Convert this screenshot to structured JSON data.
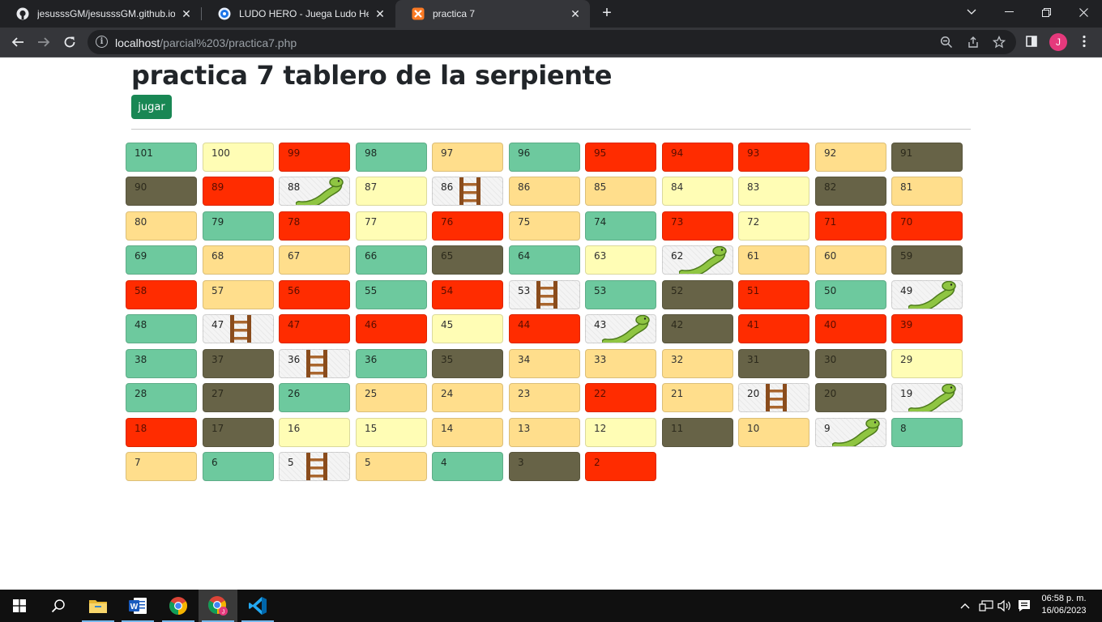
{
  "browser": {
    "tabs": [
      {
        "title": "jesusssGM/jesusssGM.github.io",
        "favicon": "github-icon"
      },
      {
        "title": "LUDO HERO - Juega Ludo Hero en",
        "favicon": "ludo-hero-icon"
      },
      {
        "title": "practica 7",
        "favicon": "xampp-icon"
      }
    ],
    "url_host": "localhost",
    "url_path": "/parcial%203/practica7.php",
    "profile_initial": "J"
  },
  "page": {
    "title": "practica 7 tablero de la serpiente",
    "play_button": "jugar"
  },
  "colors": {
    "green": "#6dc99e",
    "yellow": "#fffdb5",
    "red": "#ff2c00",
    "orange": "#ffde8c",
    "olive": "#676347",
    "play_button": "#198754"
  },
  "board": {
    "rows": [
      [
        {
          "n": "101",
          "c": "green"
        },
        {
          "n": "100",
          "c": "yellow"
        },
        {
          "n": "99",
          "c": "red"
        },
        {
          "n": "98",
          "c": "green"
        },
        {
          "n": "97",
          "c": "orange"
        },
        {
          "n": "96",
          "c": "green"
        },
        {
          "n": "95",
          "c": "red"
        },
        {
          "n": "94",
          "c": "red"
        },
        {
          "n": "93",
          "c": "red"
        },
        {
          "n": "92",
          "c": "orange"
        },
        {
          "n": "91",
          "c": "olive"
        }
      ],
      [
        {
          "n": "90",
          "c": "olive"
        },
        {
          "n": "89",
          "c": "red"
        },
        {
          "n": "88",
          "c": "snake"
        },
        {
          "n": "87",
          "c": "yellow"
        },
        {
          "n": "86",
          "c": "ladder"
        },
        {
          "n": "86",
          "c": "orange"
        },
        {
          "n": "85",
          "c": "orange"
        },
        {
          "n": "84",
          "c": "yellow"
        },
        {
          "n": "83",
          "c": "yellow"
        },
        {
          "n": "82",
          "c": "olive"
        },
        {
          "n": "81",
          "c": "orange"
        }
      ],
      [
        {
          "n": "80",
          "c": "orange"
        },
        {
          "n": "79",
          "c": "green"
        },
        {
          "n": "78",
          "c": "red"
        },
        {
          "n": "77",
          "c": "yellow"
        },
        {
          "n": "76",
          "c": "red"
        },
        {
          "n": "75",
          "c": "orange"
        },
        {
          "n": "74",
          "c": "green"
        },
        {
          "n": "73",
          "c": "red"
        },
        {
          "n": "72",
          "c": "yellow"
        },
        {
          "n": "71",
          "c": "red"
        },
        {
          "n": "70",
          "c": "red"
        }
      ],
      [
        {
          "n": "69",
          "c": "green"
        },
        {
          "n": "68",
          "c": "orange"
        },
        {
          "n": "67",
          "c": "orange"
        },
        {
          "n": "66",
          "c": "green"
        },
        {
          "n": "65",
          "c": "olive"
        },
        {
          "n": "64",
          "c": "green"
        },
        {
          "n": "63",
          "c": "yellow"
        },
        {
          "n": "62",
          "c": "snake"
        },
        {
          "n": "61",
          "c": "orange"
        },
        {
          "n": "60",
          "c": "orange"
        },
        {
          "n": "59",
          "c": "olive"
        }
      ],
      [
        {
          "n": "58",
          "c": "red"
        },
        {
          "n": "57",
          "c": "orange"
        },
        {
          "n": "56",
          "c": "red"
        },
        {
          "n": "55",
          "c": "green"
        },
        {
          "n": "54",
          "c": "red"
        },
        {
          "n": "53",
          "c": "ladder"
        },
        {
          "n": "53",
          "c": "green"
        },
        {
          "n": "52",
          "c": "olive"
        },
        {
          "n": "51",
          "c": "red"
        },
        {
          "n": "50",
          "c": "green"
        },
        {
          "n": "49",
          "c": "snake"
        }
      ],
      [
        {
          "n": "48",
          "c": "green"
        },
        {
          "n": "47",
          "c": "ladder"
        },
        {
          "n": "47",
          "c": "red"
        },
        {
          "n": "46",
          "c": "red"
        },
        {
          "n": "45",
          "c": "yellow"
        },
        {
          "n": "44",
          "c": "red"
        },
        {
          "n": "43",
          "c": "snake"
        },
        {
          "n": "42",
          "c": "olive"
        },
        {
          "n": "41",
          "c": "red"
        },
        {
          "n": "40",
          "c": "red"
        },
        {
          "n": "39",
          "c": "red"
        }
      ],
      [
        {
          "n": "38",
          "c": "green"
        },
        {
          "n": "37",
          "c": "olive"
        },
        {
          "n": "36",
          "c": "ladder"
        },
        {
          "n": "36",
          "c": "green"
        },
        {
          "n": "35",
          "c": "olive"
        },
        {
          "n": "34",
          "c": "orange"
        },
        {
          "n": "33",
          "c": "orange"
        },
        {
          "n": "32",
          "c": "orange"
        },
        {
          "n": "31",
          "c": "olive"
        },
        {
          "n": "30",
          "c": "olive"
        },
        {
          "n": "29",
          "c": "yellow"
        }
      ],
      [
        {
          "n": "28",
          "c": "green"
        },
        {
          "n": "27",
          "c": "olive"
        },
        {
          "n": "26",
          "c": "green"
        },
        {
          "n": "25",
          "c": "orange"
        },
        {
          "n": "24",
          "c": "orange"
        },
        {
          "n": "23",
          "c": "orange"
        },
        {
          "n": "22",
          "c": "red"
        },
        {
          "n": "21",
          "c": "orange"
        },
        {
          "n": "20",
          "c": "ladder"
        },
        {
          "n": "20",
          "c": "olive"
        },
        {
          "n": "19",
          "c": "snake"
        }
      ],
      [
        {
          "n": "18",
          "c": "red"
        },
        {
          "n": "17",
          "c": "olive"
        },
        {
          "n": "16",
          "c": "yellow"
        },
        {
          "n": "15",
          "c": "yellow"
        },
        {
          "n": "14",
          "c": "orange"
        },
        {
          "n": "13",
          "c": "orange"
        },
        {
          "n": "12",
          "c": "yellow"
        },
        {
          "n": "11",
          "c": "olive"
        },
        {
          "n": "10",
          "c": "orange"
        },
        {
          "n": "9",
          "c": "snake"
        },
        {
          "n": "8",
          "c": "green"
        }
      ],
      [
        {
          "n": "7",
          "c": "orange"
        },
        {
          "n": "6",
          "c": "green"
        },
        {
          "n": "5",
          "c": "ladder"
        },
        {
          "n": "5",
          "c": "orange"
        },
        {
          "n": "4",
          "c": "green"
        },
        {
          "n": "3",
          "c": "olive"
        },
        {
          "n": "2",
          "c": "red"
        }
      ]
    ]
  },
  "taskbar": {
    "apps": [
      "windows-start-icon",
      "search-icon",
      "file-explorer-icon",
      "word-icon",
      "chrome-icon",
      "chrome-profile-icon",
      "vscode-icon"
    ],
    "time": "06:58 p. m.",
    "date": "16/06/2023"
  }
}
